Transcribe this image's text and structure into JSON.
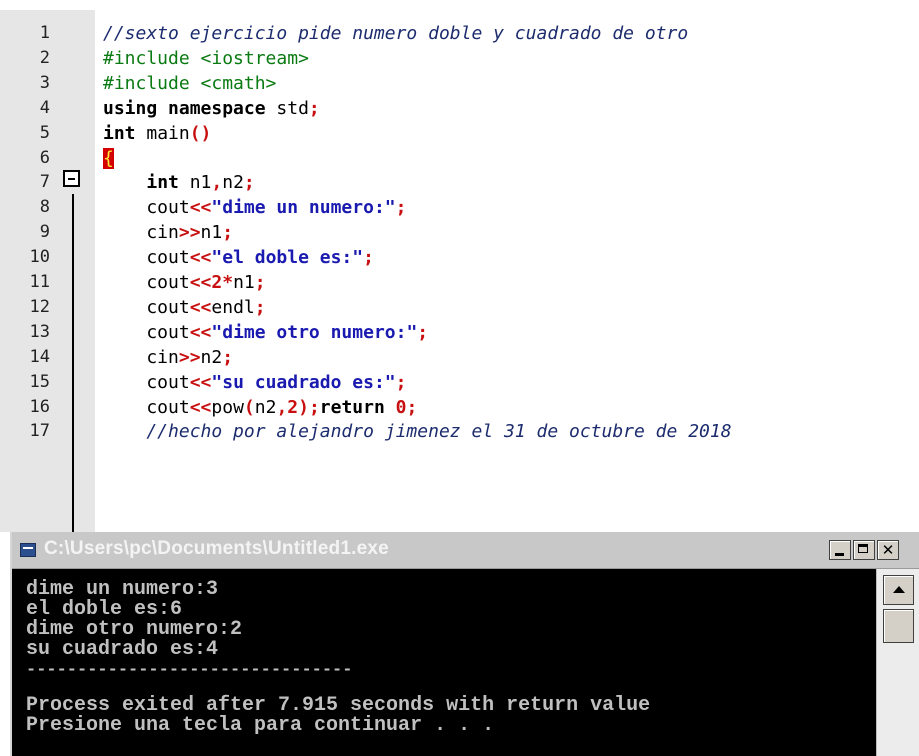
{
  "editor": {
    "lines": [
      {
        "n": "1",
        "segments": [
          {
            "t": "//sexto ejercicio pide numero doble y cuadrado de otro",
            "c": "cmt"
          }
        ]
      },
      {
        "n": "2",
        "segments": [
          {
            "t": "#include <iostream>",
            "c": "pp"
          }
        ]
      },
      {
        "n": "3",
        "segments": [
          {
            "t": "#include <cmath>",
            "c": "pp"
          }
        ]
      },
      {
        "n": "4",
        "segments": [
          {
            "t": "using namespace",
            "c": "kw"
          },
          {
            "t": " std",
            "c": ""
          },
          {
            "t": ";",
            "c": "sym"
          }
        ]
      },
      {
        "n": "5",
        "segments": [
          {
            "t": "int",
            "c": "kw"
          },
          {
            "t": " main",
            "c": ""
          },
          {
            "t": "()",
            "c": "sym"
          }
        ]
      },
      {
        "n": "6",
        "segments": [
          {
            "t": "{",
            "c": "brace"
          }
        ]
      },
      {
        "n": "7",
        "segments": [
          {
            "t": "    ",
            "c": ""
          },
          {
            "t": "int",
            "c": "kw"
          },
          {
            "t": " n1",
            "c": ""
          },
          {
            "t": ",",
            "c": "sym"
          },
          {
            "t": "n2",
            "c": ""
          },
          {
            "t": ";",
            "c": "sym"
          }
        ]
      },
      {
        "n": "8",
        "segments": [
          {
            "t": "    cout",
            "c": ""
          },
          {
            "t": "<<",
            "c": "sym"
          },
          {
            "t": "\"dime un numero:\"",
            "c": "str"
          },
          {
            "t": ";",
            "c": "sym"
          }
        ]
      },
      {
        "n": "9",
        "segments": [
          {
            "t": "    cin",
            "c": ""
          },
          {
            "t": ">>",
            "c": "sym"
          },
          {
            "t": "n1",
            "c": ""
          },
          {
            "t": ";",
            "c": "sym"
          }
        ]
      },
      {
        "n": "10",
        "segments": [
          {
            "t": "    cout",
            "c": ""
          },
          {
            "t": "<<",
            "c": "sym"
          },
          {
            "t": "\"el doble es:\"",
            "c": "str"
          },
          {
            "t": ";",
            "c": "sym"
          }
        ]
      },
      {
        "n": "11",
        "segments": [
          {
            "t": "    cout",
            "c": ""
          },
          {
            "t": "<<2*",
            "c": "sym"
          },
          {
            "t": "n1",
            "c": ""
          },
          {
            "t": ";",
            "c": "sym"
          }
        ]
      },
      {
        "n": "12",
        "segments": [
          {
            "t": "    cout",
            "c": ""
          },
          {
            "t": "<<",
            "c": "sym"
          },
          {
            "t": "endl",
            "c": ""
          },
          {
            "t": ";",
            "c": "sym"
          }
        ]
      },
      {
        "n": "13",
        "segments": [
          {
            "t": "    cout",
            "c": ""
          },
          {
            "t": "<<",
            "c": "sym"
          },
          {
            "t": "\"dime otro numero:\"",
            "c": "str"
          },
          {
            "t": ";",
            "c": "sym"
          }
        ]
      },
      {
        "n": "14",
        "segments": [
          {
            "t": "    cin",
            "c": ""
          },
          {
            "t": ">>",
            "c": "sym"
          },
          {
            "t": "n2",
            "c": ""
          },
          {
            "t": ";",
            "c": "sym"
          }
        ]
      },
      {
        "n": "15",
        "segments": [
          {
            "t": "    cout",
            "c": ""
          },
          {
            "t": "<<",
            "c": "sym"
          },
          {
            "t": "\"su cuadrado es:\"",
            "c": "str"
          },
          {
            "t": ";",
            "c": "sym"
          }
        ]
      },
      {
        "n": "16",
        "segments": [
          {
            "t": "    cout",
            "c": ""
          },
          {
            "t": "<<",
            "c": "sym"
          },
          {
            "t": "pow",
            "c": ""
          },
          {
            "t": "(",
            "c": "sym"
          },
          {
            "t": "n2",
            "c": ""
          },
          {
            "t": ",2);",
            "c": "sym"
          },
          {
            "t": "return",
            "c": "kw"
          },
          {
            "t": " 0",
            "c": "sym"
          },
          {
            "t": ";",
            "c": "sym"
          }
        ]
      },
      {
        "n": "17",
        "segments": [
          {
            "t": "    //hecho por alejandro jimenez el 31 de octubre de 2018",
            "c": "cmt"
          }
        ]
      }
    ]
  },
  "console": {
    "title": "C:\\Users\\pc\\Documents\\Untitled1.exe",
    "close_glyph": "✕",
    "output": [
      "dime un numero:3",
      "el doble es:6",
      "dime otro numero:2",
      "su cuadrado es:4",
      "--------------------------------",
      "Process exited after 7.915 seconds with return value",
      "Presione una tecla para continuar . . ."
    ]
  },
  "colors": {
    "comment": "#1c2c6e",
    "preprocessor": "#0a7a12",
    "symbol": "#c81010",
    "string": "#1a1ab0",
    "terminal_bg": "#000000",
    "terminal_fg": "#c0c0c0"
  }
}
